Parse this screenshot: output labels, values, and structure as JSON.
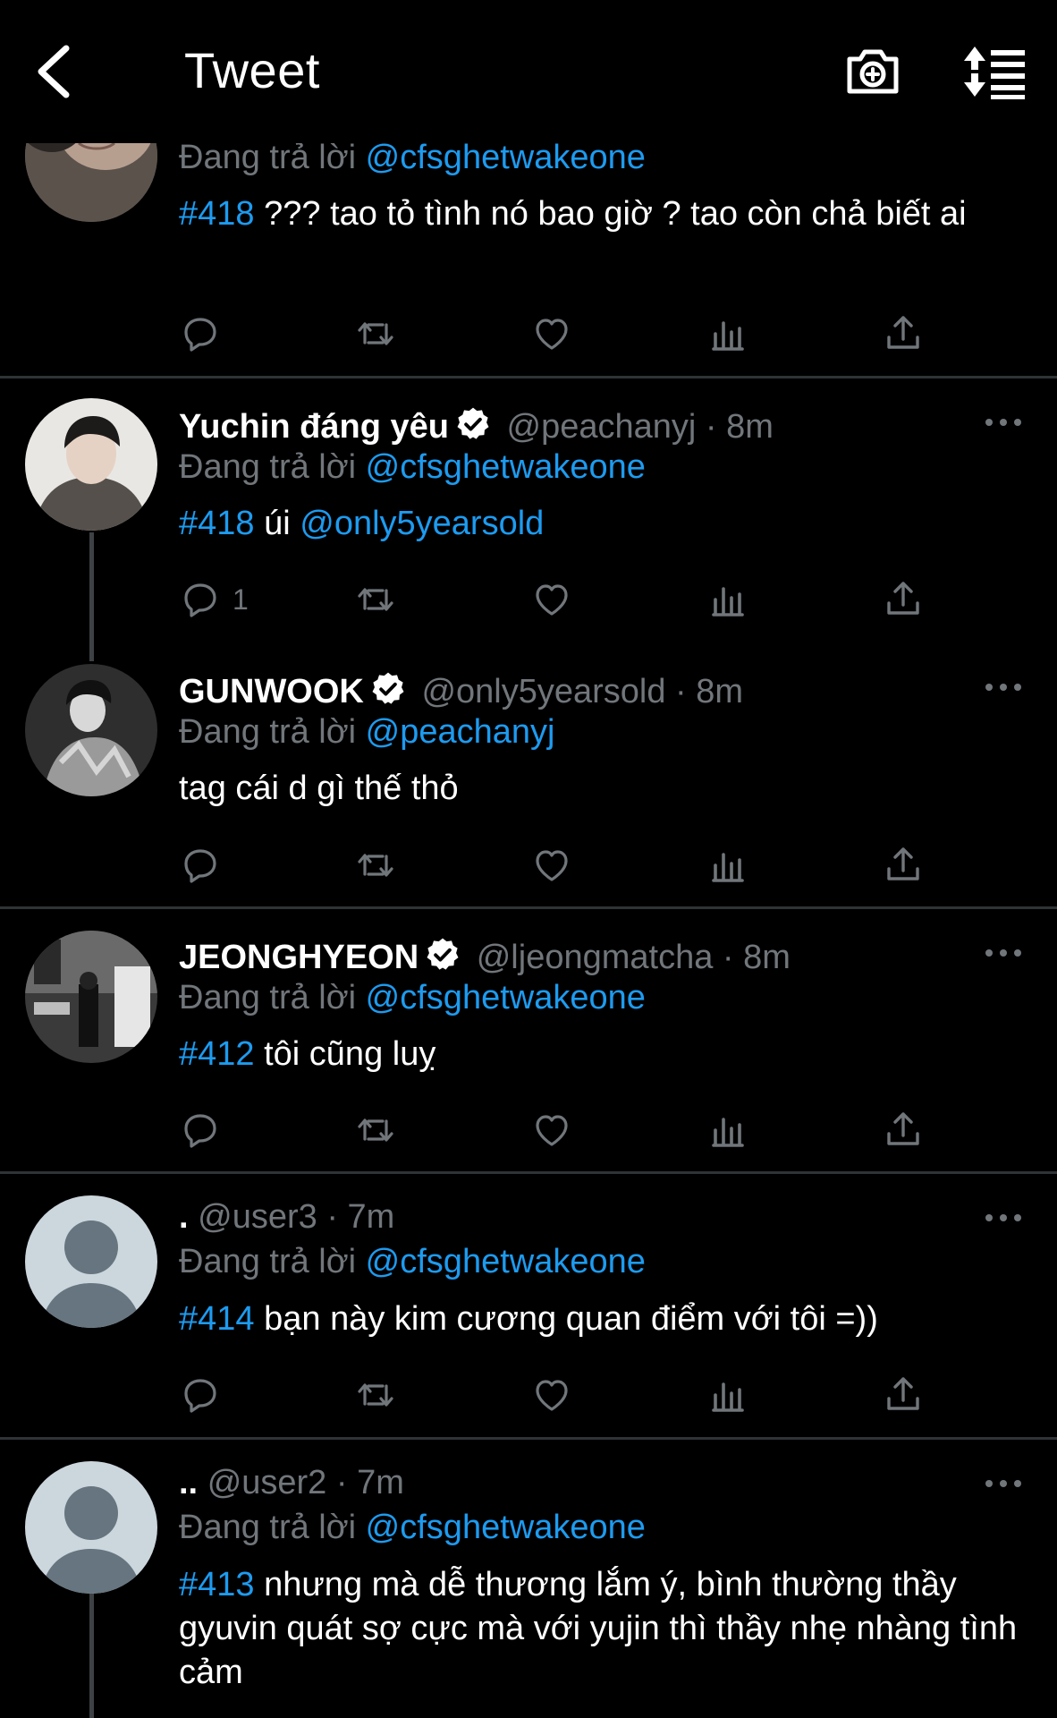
{
  "header": {
    "title": "Tweet"
  },
  "reply_prefix": "Đang trả lời",
  "tweets": [
    {
      "name": "",
      "handle": "",
      "time": "",
      "reply_to": "@cfsghetwakeone",
      "hashtag": "#418",
      "text": " ??? tao tỏ tình nó bao giờ ? tao còn chả biết ai",
      "mention": "",
      "reply_count": ""
    },
    {
      "name": "Yuchin đáng yêu",
      "handle": "@peachanyj",
      "time": "8m",
      "reply_to": "@cfsghetwakeone",
      "hashtag": "#418",
      "text": " úi ",
      "mention": "@only5yearsold",
      "reply_count": "1"
    },
    {
      "name": "GUNWOOK",
      "handle": "@only5yearsold",
      "time": "8m",
      "reply_to": "@peachanyj",
      "hashtag": "",
      "text": "tag cái d gì thế thỏ",
      "mention": "",
      "reply_count": ""
    },
    {
      "name": "JEONGHYEON",
      "handle": "@ljeongmatcha",
      "time": "8m",
      "reply_to": "@cfsghetwakeone",
      "hashtag": "#412",
      "text": " tôi cũng luỵ",
      "mention": "",
      "reply_count": ""
    },
    {
      "name": ".",
      "handle": "@user3",
      "time": "7m",
      "reply_to": "@cfsghetwakeone",
      "hashtag": "#414",
      "text": " bạn này kim cương quan điểm với tôi =))",
      "mention": "",
      "reply_count": ""
    },
    {
      "name": "..",
      "handle": "@user2",
      "time": "7m",
      "reply_to": "@cfsghetwakeone",
      "hashtag": "#413",
      "text": " nhưng mà dễ thương lắm ý, bình thường thầy gyuvin quát sợ cực mà với yujin thì thầy nhẹ nhàng tình cảm",
      "mention": "",
      "reply_count": ""
    }
  ],
  "sep": " · ",
  "icons": {
    "back": "chevron-left-icon",
    "camera": "camera-plus-icon",
    "sort": "sort-icon",
    "reply": "reply-icon",
    "retweet": "retweet-icon",
    "like": "heart-icon",
    "views": "views-icon",
    "share": "share-icon",
    "verified": "verified-badge-icon",
    "more": "more-icon"
  },
  "colors": {
    "background": "#000000",
    "link": "#1d9bf0",
    "muted": "#71767b",
    "divider": "#2f3336"
  }
}
